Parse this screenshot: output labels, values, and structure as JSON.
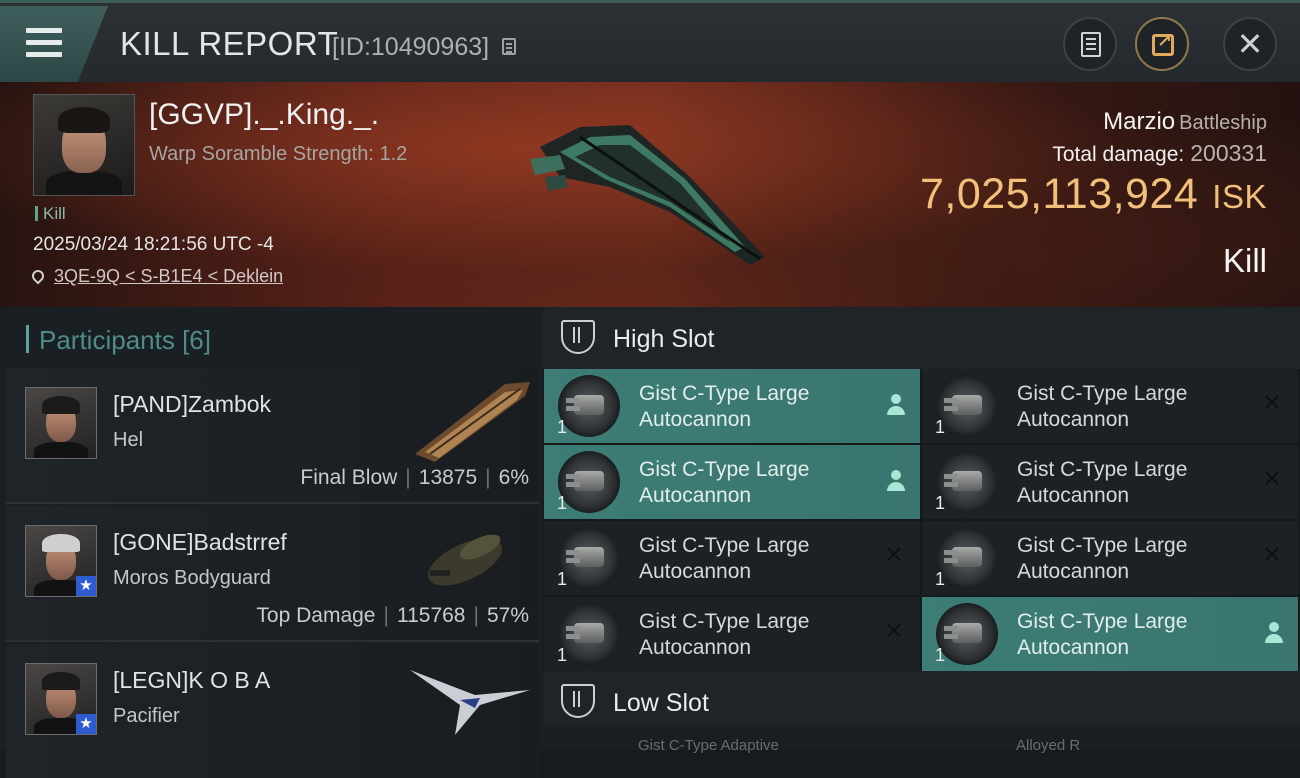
{
  "header": {
    "title": "KILL REPORT",
    "kill_id": "[ID:10490963]",
    "icons": {
      "menu": "hamburger-menu-icon",
      "copy": "copy-icon",
      "report": "document-icon",
      "share": "share-icon",
      "close": "close-icon"
    }
  },
  "victim": {
    "name": "[GGVP]._.King._.",
    "scramble": "Warp Soramble Strength: 1.2",
    "tag": "Kill",
    "datetime": "2025/03/24 18:21:56 UTC -4",
    "location": "3QE-9Q < S-B1E4 < Deklein",
    "ship_name": "Marzio",
    "ship_class": "Battleship",
    "total_damage_label": "Total damage:",
    "total_damage": "200331",
    "isk_value": "7,025,113,924",
    "isk_unit": "ISK",
    "result": "Kill"
  },
  "participants": {
    "header": "Participants [6]",
    "rows": [
      {
        "name": "[PAND]Zambok",
        "ship": "Hel",
        "role": "Final Blow",
        "damage": "13875",
        "percent": "6%"
      },
      {
        "name": "[GONE]Badstrref",
        "ship": "Moros Bodyguard",
        "role": "Top Damage",
        "damage": "115768",
        "percent": "57%"
      },
      {
        "name": "[LEGN]K O B A",
        "ship": "Pacifier"
      }
    ]
  },
  "fittings": {
    "high_slot_title": "High Slot",
    "low_slot_title": "Low Slot",
    "high_modules": [
      {
        "qty": "1",
        "line1": "Gist C-Type Large",
        "line2": "Autocannon",
        "state": "dropped"
      },
      {
        "qty": "1",
        "line1": "Gist C-Type Large",
        "line2": "Autocannon",
        "state": "destroyed"
      },
      {
        "qty": "1",
        "line1": "Gist C-Type Large",
        "line2": "Autocannon",
        "state": "dropped"
      },
      {
        "qty": "1",
        "line1": "Gist C-Type Large",
        "line2": "Autocannon",
        "state": "destroyed"
      },
      {
        "qty": "1",
        "line1": "Gist C-Type Large",
        "line2": "Autocannon",
        "state": "destroyed"
      },
      {
        "qty": "1",
        "line1": "Gist C-Type Large",
        "line2": "Autocannon",
        "state": "destroyed"
      },
      {
        "qty": "1",
        "line1": "Gist C-Type Large",
        "line2": "Autocannon",
        "state": "destroyed"
      },
      {
        "qty": "1",
        "line1": "Gist C-Type Large",
        "line2": "Autocannon",
        "state": "dropped"
      }
    ],
    "low_preview": [
      "Gist C-Type Adaptive",
      "Alloyed R"
    ]
  },
  "colors": {
    "accent_teal": "#3d7d76",
    "isk_gold": "#f1c07a",
    "participants_header": "#4f8c86"
  }
}
